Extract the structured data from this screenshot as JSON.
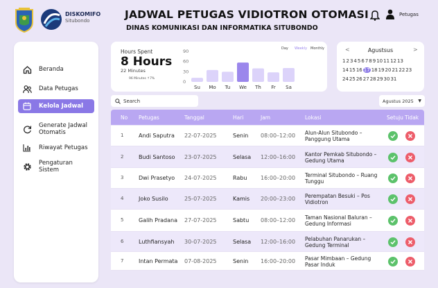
{
  "brand": {
    "name": "DISKOMIFO",
    "sub": "Situbondo"
  },
  "header": {
    "title": "JADWAL PETUGAS VIDIOTRON OTOMASI",
    "subtitle": "DINAS KOMUNIKASI DAN INFORMATIKA SITUBONDO",
    "user": "Petugas"
  },
  "sidebar": {
    "items": [
      {
        "label": "Beranda",
        "icon": "home-icon"
      },
      {
        "label": "Data Petugas",
        "icon": "users-icon"
      },
      {
        "label": "Kelola Jadwal",
        "icon": "calendar-icon"
      },
      {
        "label": "Generate Jadwal Otomatis",
        "icon": "refresh-icon"
      },
      {
        "label": "Riwayat Petugas",
        "icon": "bar-chart-icon"
      },
      {
        "label": "Pengaturan Sistem",
        "icon": "gear-icon"
      }
    ]
  },
  "stats": {
    "hours_label": "Hours Spent",
    "hours_value": "8 Hours",
    "minutes": "22 Minutes",
    "trend": "96 Minutes ↑7%",
    "tabs": [
      "Day",
      "Weekly",
      "Monthly"
    ]
  },
  "chart_data": {
    "type": "bar",
    "categories": [
      "Su",
      "Mo",
      "Tu",
      "We",
      "Th",
      "Fr",
      "Sa"
    ],
    "values": [
      12,
      35,
      30,
      57,
      40,
      28,
      41
    ],
    "ylim": [
      0,
      90
    ],
    "yticks": [
      "0",
      "30",
      "60",
      "90"
    ],
    "highlight": "We",
    "colors": {
      "bar": "#dcd3fa",
      "highlight": "#9b87ec"
    }
  },
  "calendar": {
    "month": "Agustsus",
    "prev": "<",
    "next": ">",
    "rows": [
      [
        "1",
        "2",
        "3",
        "4",
        "5",
        "6",
        "7",
        "8",
        "9",
        "10",
        "11",
        "12",
        "13"
      ],
      [
        "14",
        "15",
        "16",
        "17",
        "18",
        "19",
        "20",
        "21",
        "22",
        "23"
      ],
      [
        "24",
        "25",
        "26",
        "27",
        "28",
        "29",
        "30",
        "31"
      ]
    ],
    "selected": "17"
  },
  "search": {
    "placeholder": "Search"
  },
  "filter": {
    "value": "Agustus 2025"
  },
  "table": {
    "columns": {
      "no": "No",
      "petugas": "Petugas",
      "tanggal": "Tanggal",
      "hari": "Hari",
      "jam": "Jam",
      "lokasi": "Lokasi",
      "setuju": "Setuju",
      "tidak": "Tidak"
    },
    "rows": [
      {
        "no": "1",
        "petugas": "Andi Saputra",
        "tanggal": "22-07-2025",
        "hari": "Senin",
        "jam": "08:00–12:00",
        "lokasi": "Alun-Alun Situbondo – Panggung Utama"
      },
      {
        "no": "2",
        "petugas": "Budi Santoso",
        "tanggal": "23-07-2025",
        "hari": "Selasa",
        "jam": "12:00–16:00",
        "lokasi": "Kantor Pemkab Situbondo – Gedung Utama"
      },
      {
        "no": "3",
        "petugas": "Dwi Prasetyo",
        "tanggal": "24-07-2025",
        "hari": "Rabu",
        "jam": "16:00–20:00",
        "lokasi": "Terminal Situbondo – Ruang Tunggu"
      },
      {
        "no": "4",
        "petugas": "Joko Susilo",
        "tanggal": "25-07-2025",
        "hari": "Kamis",
        "jam": "20:00–23:00",
        "lokasi": "Perempatan Besuki – Pos Vidiotron"
      },
      {
        "no": "5",
        "petugas": "Galih Pradana",
        "tanggal": "27-07-2025",
        "hari": "Sabtu",
        "jam": "08:00–12:00",
        "lokasi": "Taman Nasional Baluran – Gedung Informasi"
      },
      {
        "no": "6",
        "petugas": "Luthfiansyah",
        "tanggal": "30-07-2025",
        "hari": "Selasa",
        "jam": "12:00–16:00",
        "lokasi": "Pelabuhan Panarukan – Gedung Terminal"
      },
      {
        "no": "7",
        "petugas": "Intan Permata",
        "tanggal": "07-08-2025",
        "hari": "Senin",
        "jam": "16:00–20:00",
        "lokasi": "Pasar Mimbaan – Gedung Pasar Induk"
      }
    ]
  },
  "colors": {
    "accent": "#8a78e6",
    "header": "#b9a7f2",
    "approve": "#5cc26b",
    "reject": "#ed5d6a"
  }
}
